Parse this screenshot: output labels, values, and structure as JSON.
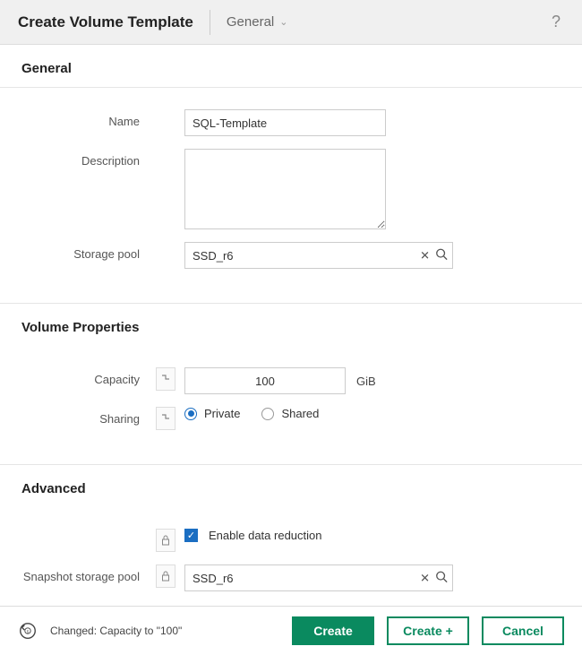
{
  "header": {
    "title": "Create Volume Template",
    "tab": "General"
  },
  "sections": {
    "general": {
      "title": "General"
    },
    "volume_props": {
      "title": "Volume Properties"
    },
    "advanced": {
      "title": "Advanced"
    }
  },
  "labels": {
    "name": "Name",
    "description": "Description",
    "storage_pool": "Storage pool",
    "capacity": "Capacity",
    "sharing": "Sharing",
    "snapshot_pool": "Snapshot storage pool",
    "enable_data_reduction": "Enable data reduction",
    "private": "Private",
    "shared": "Shared"
  },
  "values": {
    "name": "SQL-Template",
    "description": "",
    "storage_pool": "SSD_r6",
    "capacity": "100",
    "capacity_unit": "GiB",
    "sharing": "private",
    "enable_data_reduction": true,
    "snapshot_pool": "SSD_r6"
  },
  "footer": {
    "status": "Changed: Capacity to \"100\"",
    "create": "Create",
    "create_plus": "Create +",
    "cancel": "Cancel"
  }
}
